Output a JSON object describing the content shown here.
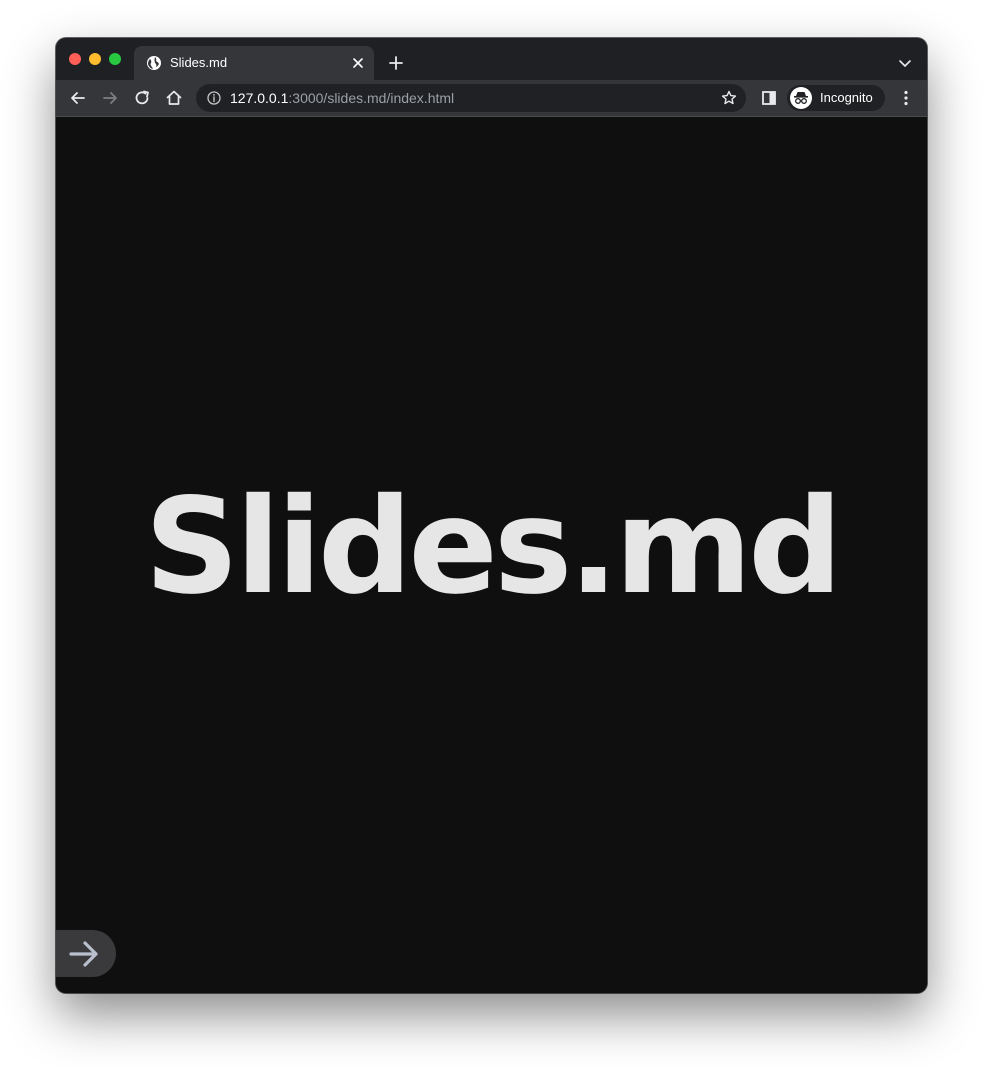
{
  "browser": {
    "tab": {
      "title": "Slides.md"
    },
    "address_bar": {
      "host": "127.0.0.1",
      "rest": ":3000/slides.md/index.html"
    },
    "profile": {
      "label": "Incognito"
    }
  },
  "slide": {
    "title": "Slides.md"
  },
  "colors": {
    "titlebar": "#1f2024",
    "toolbar": "#35363a",
    "page_background": "#0f0f0f",
    "slide_text": "#e6e6e6",
    "next_button": "#3a3a3c"
  },
  "icons": {
    "tab_favicon": "globe-icon",
    "tab_close": "close-icon",
    "new_tab": "plus-icon",
    "tab_search": "chevron-down-icon",
    "back": "arrow-left-icon",
    "forward": "arrow-right-icon",
    "reload": "reload-icon",
    "home": "home-icon",
    "site_info": "info-icon",
    "bookmark": "star-icon",
    "side_panel": "side-panel-icon",
    "incognito": "incognito-icon",
    "menu": "kebab-menu-icon",
    "next_slide": "arrow-right-icon"
  }
}
